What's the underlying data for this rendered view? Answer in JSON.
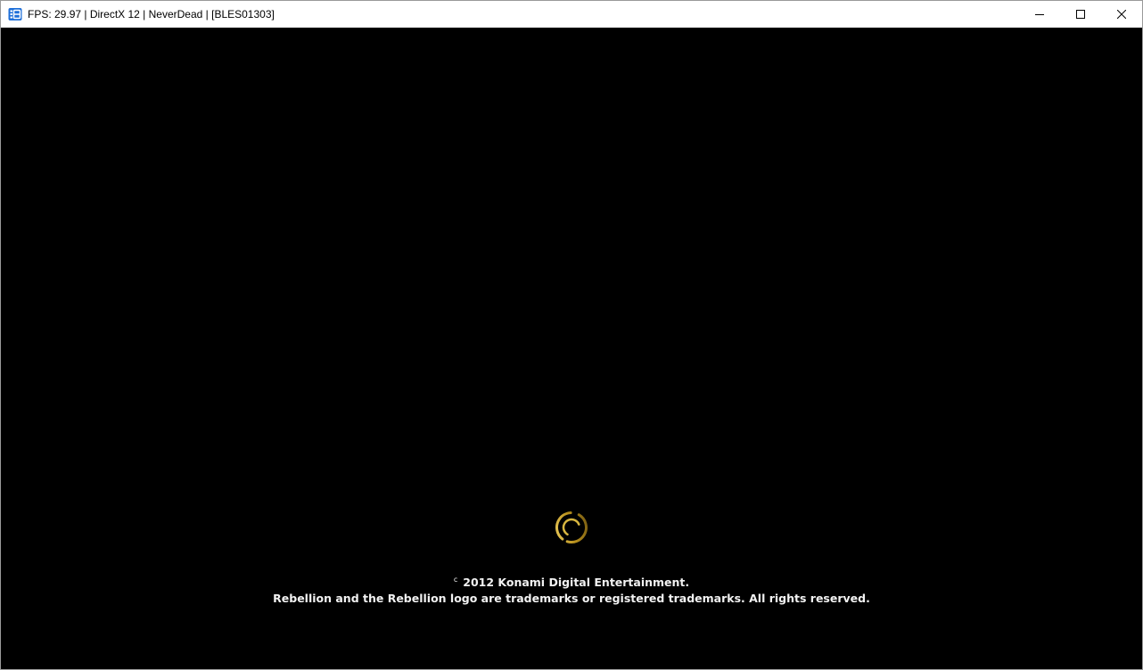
{
  "window": {
    "title": "FPS: 29.97 | DirectX 12 | NeverDead | [BLES01303]",
    "app_icon": "rpcs3-icon",
    "controls": {
      "minimize_icon": "minimize-icon",
      "maximize_icon": "maximize-icon",
      "close_icon": "close-icon"
    }
  },
  "game": {
    "loading_indicator": "loading-spinner-icon",
    "accent_color": "#c9a227",
    "copyright": {
      "symbol": "c",
      "line1": "2012 Konami Digital Entertainment.",
      "line2": "Rebellion and the Rebellion logo are trademarks or registered trademarks. All rights reserved."
    }
  }
}
